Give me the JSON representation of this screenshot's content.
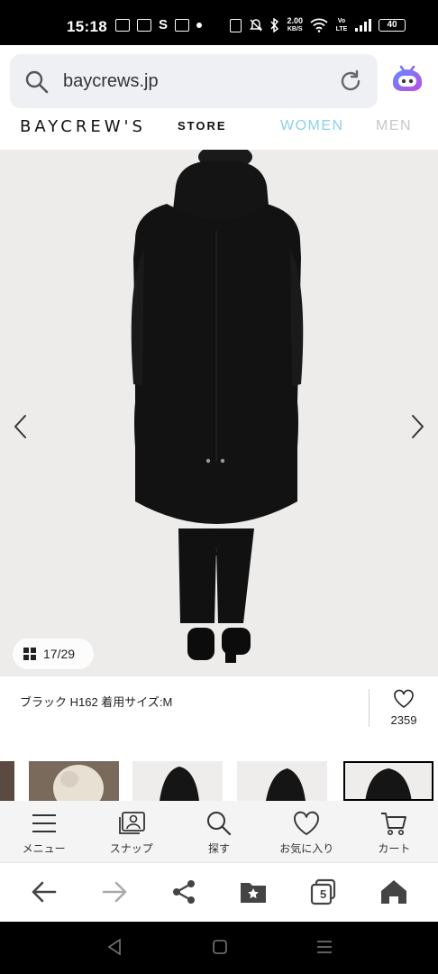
{
  "status_bar": {
    "time": "15:18",
    "net_speed_value": "2.00",
    "net_speed_unit": "KB/S",
    "volte": "Vo LTE",
    "battery": "40",
    "icons": [
      "gallery-icon",
      "person-icon",
      "s-icon",
      "mail-icon",
      "dot-icon",
      "nfc-icon",
      "mute-icon",
      "bluetooth-icon",
      "wifi-icon",
      "volte-icon",
      "signal-icon",
      "battery-icon"
    ]
  },
  "browser": {
    "url": "baycrews.jp",
    "icons": [
      "search-icon",
      "reload-icon",
      "assistant-icon"
    ]
  },
  "site_header": {
    "logo": "BAYCREW'S",
    "logo_suffix": "STORE",
    "nav_women": "WOMEN",
    "nav_men": "MEN",
    "accent_color": "#8fd0e8"
  },
  "gallery": {
    "counter_current": "17",
    "counter_total": "29",
    "counter_sep": "/",
    "background": "#eeeceb"
  },
  "product": {
    "variant_text": "ブラック H162 着用サイズ:M",
    "like_count": "2359"
  },
  "site_nav": {
    "items": [
      {
        "label": "メニュー",
        "icon": "menu-icon"
      },
      {
        "label": "スナップ",
        "icon": "snap-icon"
      },
      {
        "label": "探す",
        "icon": "search-icon"
      },
      {
        "label": "お気に入り",
        "icon": "heart-icon"
      },
      {
        "label": "カート",
        "icon": "cart-icon"
      }
    ]
  },
  "toolbar": {
    "tab_count": "5",
    "icons": [
      "back-icon",
      "forward-icon",
      "share-icon",
      "bookmark-folder-icon",
      "tabs-icon",
      "home-icon"
    ]
  }
}
